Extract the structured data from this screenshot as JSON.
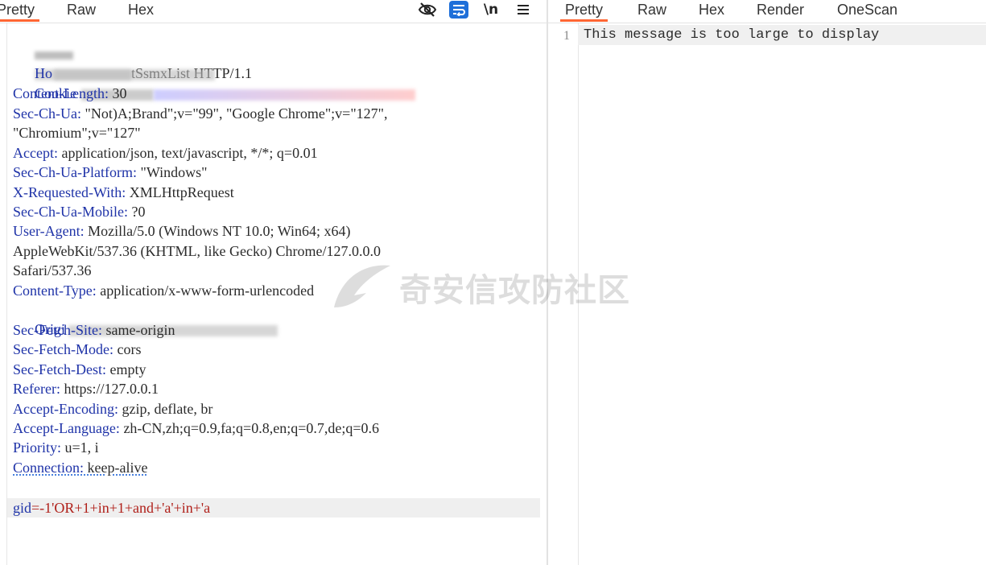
{
  "request_pane": {
    "tabs": [
      "Pretty",
      "Raw",
      "Hex"
    ],
    "active_tab": "Pretty",
    "toolbar": {
      "newline_label": "\\n"
    },
    "lines": [
      {
        "key": "",
        "value": "tSsmxList HTTP/1.1"
      },
      {
        "key": "Ho",
        "value": ""
      },
      {
        "key": "Cookie",
        "value": ""
      },
      {
        "key": "Content-Length:",
        "value": " 30"
      },
      {
        "key": "Sec-Ch-Ua:",
        "value": " \"Not)A;Brand\";v=\"99\", \"Google Chrome\";v=\"127\","
      },
      {
        "key": "",
        "value": "\"Chromium\";v=\"127\""
      },
      {
        "key": "Accept:",
        "value": " application/json, text/javascript, */*; q=0.01"
      },
      {
        "key": "Sec-Ch-Ua-Platform:",
        "value": " \"Windows\""
      },
      {
        "key": "X-Requested-With:",
        "value": " XMLHttpRequest"
      },
      {
        "key": "Sec-Ch-Ua-Mobile:",
        "value": " ?0"
      },
      {
        "key": "User-Agent:",
        "value": " Mozilla/5.0 (Windows NT 10.0; Win64; x64)"
      },
      {
        "key": "",
        "value": "AppleWebKit/537.36 (KHTML, like Gecko) Chrome/127.0.0.0"
      },
      {
        "key": "",
        "value": "Safari/537.36"
      },
      {
        "key": "Content-Type:",
        "value": " application/x-www-form-urlencoded"
      },
      {
        "key": "Origi",
        "value": ""
      },
      {
        "key": "Sec-Fetch-Site:",
        "value": " same-origin"
      },
      {
        "key": "Sec-Fetch-Mode:",
        "value": " cors"
      },
      {
        "key": "Sec-Fetch-Dest:",
        "value": " empty"
      },
      {
        "key": "Referer:",
        "value": " https://127.0.0.1"
      },
      {
        "key": "Accept-Encoding:",
        "value": " gzip, deflate, br"
      },
      {
        "key": "Accept-Language:",
        "value": " zh-CN,zh;q=0.9,fa;q=0.8,en;q=0.7,de;q=0.6"
      },
      {
        "key": "Priority:",
        "value": " u=1, i"
      },
      {
        "key": "Connection:",
        "value": " keep-alive"
      }
    ],
    "body": {
      "key": "gid",
      "value": "=-1'OR+1+in+1+and+'a'+in+'a"
    }
  },
  "response_pane": {
    "tabs": [
      "Pretty",
      "Raw",
      "Hex",
      "Render",
      "OneScan"
    ],
    "active_tab": "Pretty",
    "line_number": "1",
    "message": "This message is too large to display"
  },
  "watermark": {
    "text": "奇安信攻防社区"
  },
  "colors": {
    "accent": "#ff6633",
    "header_key": "#1f33a8",
    "body_value": "#b0201a",
    "wrap_button": "#1e6fd9"
  }
}
